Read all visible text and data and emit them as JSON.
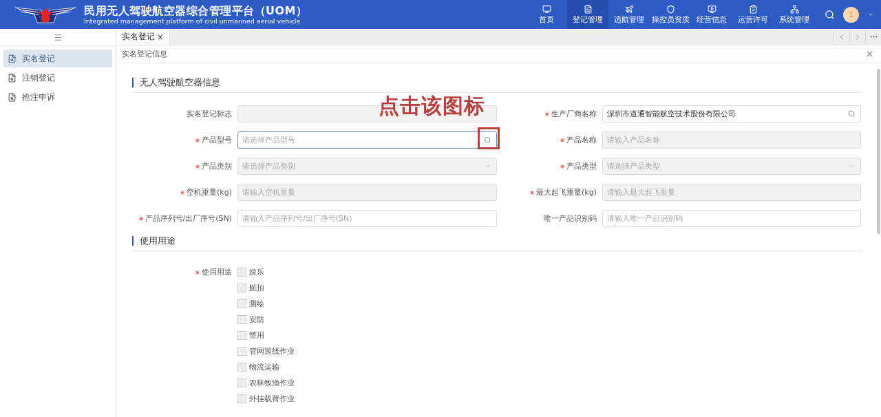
{
  "header": {
    "title": "民用无人驾驶航空器综合管理平台（UOM）",
    "subtitle": "Integrated management platform of civil unmanned aerial vehicle",
    "nav": [
      {
        "label": "首页",
        "selected": false
      },
      {
        "label": "登记管理",
        "selected": true
      },
      {
        "label": "适航管理",
        "selected": false
      },
      {
        "label": "操控员资质",
        "selected": false
      },
      {
        "label": "经营信息",
        "selected": false
      },
      {
        "label": "运营许可",
        "selected": false
      },
      {
        "label": "系统管理",
        "selected": false
      }
    ],
    "avatar": "1"
  },
  "sidebar": {
    "items": [
      {
        "label": "实名登记",
        "selected": true
      },
      {
        "label": "注销登记",
        "selected": false
      },
      {
        "label": "抢注申诉",
        "selected": false
      }
    ]
  },
  "tabs": [
    {
      "label": "实名登记",
      "close": "×",
      "selected": true
    }
  ],
  "breadcrumb": "实名登记信息",
  "sections": [
    {
      "title": "无人驾驶航空器信息"
    },
    {
      "title": "使用用途"
    }
  ],
  "annotation": {
    "text": "点击该图标"
  },
  "fields": [
    {
      "label": "实名登记标志",
      "kind": "input",
      "required": false,
      "disabled": true,
      "highlighted": false
    },
    {
      "label": "生产厂商名称",
      "kind": "search",
      "required": true,
      "disabled": false,
      "highlighted": false,
      "value": "深圳市道通智能航空技术股份有限公司"
    },
    {
      "label": "产品型号",
      "kind": "search",
      "required": true,
      "disabled": false,
      "highlighted": true,
      "placeholder": "请选择产品型号"
    },
    {
      "label": "产品名称",
      "kind": "input",
      "required": true,
      "disabled": true,
      "highlighted": false,
      "placeholder": "请输入产品名称"
    },
    {
      "label": "产品类别",
      "kind": "select",
      "required": true,
      "disabled": true,
      "highlighted": false,
      "placeholder": "请选择产品类别"
    },
    {
      "label": "产品类型",
      "kind": "select",
      "required": true,
      "disabled": true,
      "highlighted": false,
      "placeholder": "请选择产品类型"
    },
    {
      "label": "空机重量(kg)",
      "kind": "input",
      "required": true,
      "disabled": true,
      "highlighted": false,
      "placeholder": "请输入空机重量"
    },
    {
      "label": "最大起飞重量(kg)",
      "kind": "input",
      "required": true,
      "disabled": true,
      "highlighted": false,
      "placeholder": "请输入最大起飞重量"
    },
    {
      "label": "产品序列号/出厂序号(SN)",
      "kind": "input",
      "required": true,
      "disabled": false,
      "highlighted": false,
      "placeholder": "请输入产品序列号/出厂序号(SN)"
    },
    {
      "label": "唯一产品识别码",
      "kind": "input",
      "required": false,
      "disabled": false,
      "highlighted": false,
      "placeholder": "请输入唯一产品识别码"
    }
  ],
  "usage": {
    "label": "使用用途",
    "required": true,
    "options": [
      {
        "label": "娱乐",
        "checked": false
      },
      {
        "label": "航拍",
        "checked": false
      },
      {
        "label": "测绘",
        "checked": false
      },
      {
        "label": "安防",
        "checked": false
      },
      {
        "label": "警用",
        "checked": false
      },
      {
        "label": "管网巡线作业",
        "checked": false
      },
      {
        "label": "物流运输",
        "checked": false
      },
      {
        "label": "农林牧渔作业",
        "checked": false
      },
      {
        "label": "外挂载荷作业",
        "checked": false
      }
    ]
  }
}
